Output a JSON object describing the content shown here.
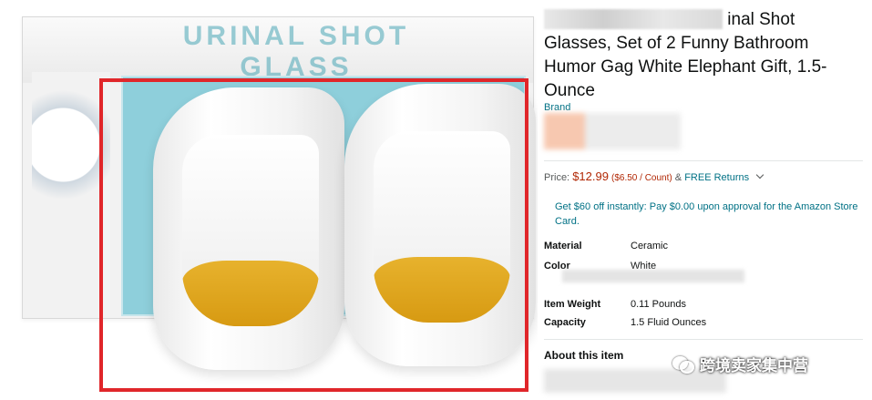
{
  "product": {
    "title_visible": "inal Shot Glasses, Set of 2 Funny Bathroom Humor Gag White Elephant Gift, 1.5-Ounce",
    "brand_label": "Brand",
    "price_label": "Price:",
    "price": "$12.99",
    "unit_price": "($6.50 / Count)",
    "amp": "&",
    "free_returns": "FREE Returns",
    "promo": "Get $60 off instantly: Pay $0.00 upon approval for the Amazon Store Card.",
    "specs": [
      {
        "key": "Material",
        "value": "Ceramic"
      },
      {
        "key": "Color",
        "value": "White"
      },
      {
        "key": "Item Weight",
        "value": "0.11 Pounds"
      },
      {
        "key": "Capacity",
        "value": "1.5 Fluid Ounces"
      }
    ],
    "about_title": "About this item"
  },
  "image": {
    "box_brand_print": "URINAL SHOT GLASS",
    "highlight_color": "#e0262a"
  },
  "watermark": {
    "text": "跨境卖家集中营",
    "icon": "wechat-icon"
  },
  "colors": {
    "price": "#b12704",
    "link": "#007185"
  }
}
